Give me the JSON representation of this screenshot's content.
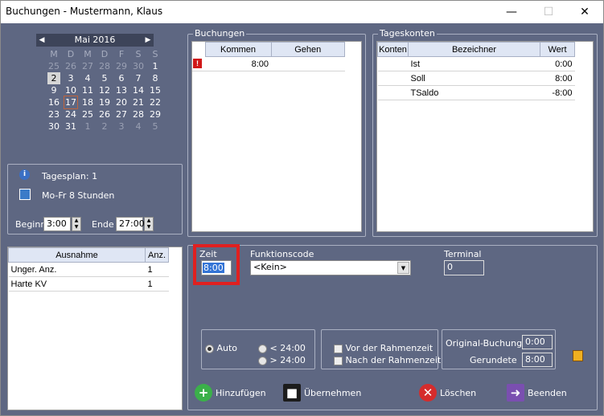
{
  "window": {
    "title": "Buchungen - Mustermann, Klaus"
  },
  "calendar": {
    "month": "Mai 2016",
    "dow": [
      "M",
      "D",
      "M",
      "D",
      "F",
      "S",
      "S"
    ],
    "weeks": [
      [
        "25",
        "26",
        "27",
        "28",
        "29",
        "30",
        "1"
      ],
      [
        "2",
        "3",
        "4",
        "5",
        "6",
        "7",
        "8"
      ],
      [
        "9",
        "10",
        "11",
        "12",
        "13",
        "14",
        "15"
      ],
      [
        "16",
        "17",
        "18",
        "19",
        "20",
        "21",
        "22"
      ],
      [
        "23",
        "24",
        "25",
        "26",
        "27",
        "28",
        "29"
      ],
      [
        "30",
        "31",
        "1",
        "2",
        "3",
        "4",
        "5"
      ]
    ]
  },
  "day": {
    "tagesplan": "Tagesplan: 1",
    "schedule": "Mo-Fr 8 Stunden",
    "beginn_label": "Beginn",
    "beginn": "3:00",
    "ende_label": "Ende",
    "ende": "27:00"
  },
  "ausnahme": {
    "headers": [
      "Ausnahme",
      "Anz."
    ],
    "rows": [
      [
        "Unger. Anz.",
        "1"
      ],
      [
        "Harte KV",
        "1"
      ]
    ]
  },
  "buchungen": {
    "legend": "Buchungen",
    "headers": [
      "Kommen",
      "Gehen"
    ],
    "rows": [
      [
        "8:00",
        ""
      ]
    ]
  },
  "tageskonten": {
    "legend": "Tageskonten",
    "headers": [
      "Konten",
      "Bezeichner",
      "Wert"
    ],
    "rows": [
      [
        "",
        "Ist",
        "0:00"
      ],
      [
        "",
        "Soll",
        "8:00"
      ],
      [
        "",
        "TSaldo",
        "-8:00"
      ]
    ]
  },
  "form": {
    "zeit_label": "Zeit",
    "zeit": "8:00",
    "funktion_label": "Funktionscode",
    "funktion": "<Kein>",
    "terminal_label": "Terminal",
    "terminal": "0",
    "auto": "Auto",
    "lt24": "< 24:00",
    "gt24": "> 24:00",
    "vor": "Vor der Rahmenzeit",
    "nach": "Nach der Rahmenzeit",
    "original_label": "Original-Buchung",
    "original": "0:00",
    "gerundete_label": "Gerundete",
    "gerundete": "8:00"
  },
  "buttons": {
    "hinzufuegen": "Hinzufügen",
    "uebernehmen": "Übernehmen",
    "loeschen": "Löschen",
    "beenden": "Beenden"
  },
  "colors": {
    "accent": "#e02020",
    "background": "#5e6782"
  }
}
